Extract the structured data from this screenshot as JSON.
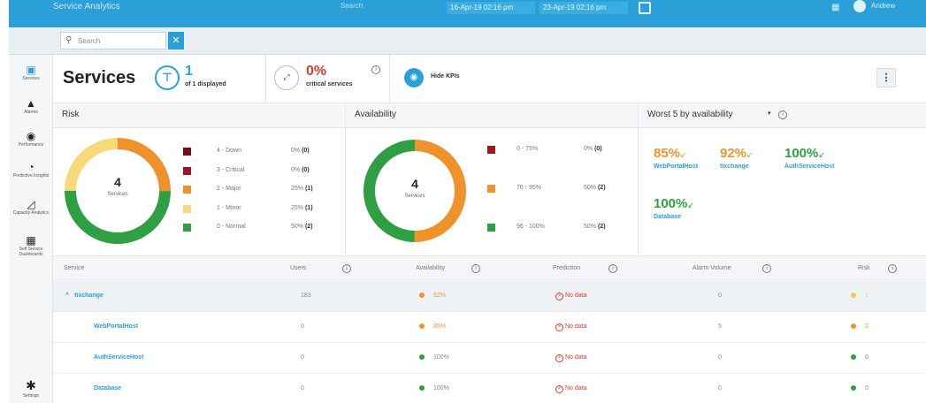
{
  "topbar": {
    "title": "Service Analytics",
    "search_placeholder": "Search",
    "date_from": "16-Apr-19 02:16 pm",
    "date_to": "23-Apr-19 02:16 pm",
    "user_label": "Andrew"
  },
  "subbar": {
    "search_placeholder": "Search",
    "clear_label": "✕"
  },
  "nav": [
    {
      "label": "Services",
      "icon": "services-icon",
      "glyph": "▣"
    },
    {
      "label": "Alarms",
      "icon": "alarm-icon",
      "glyph": "▲"
    },
    {
      "label": "Performance",
      "icon": "performance-icon",
      "glyph": "◉"
    },
    {
      "label": "Predictive Insights",
      "icon": "insights-icon",
      "glyph": "◔"
    },
    {
      "label": "Capacity Analytics",
      "icon": "capacity-icon",
      "glyph": "◿"
    },
    {
      "label": "Self Service Dashboards",
      "icon": "dashboards-icon",
      "glyph": "▦"
    }
  ],
  "settings": {
    "label": "Settings",
    "glyph": "✱"
  },
  "header": {
    "title": "Services",
    "displayed_count": "1",
    "displayed_sub": "of 1 displayed",
    "critical_pct": "0%",
    "critical_sub": "critical services",
    "hide_kpis": "Hide KPIs",
    "more": "⋮"
  },
  "panels": {
    "risk_title": "Risk",
    "availability_title": "Availability",
    "worst_title": "Worst 5 by availability"
  },
  "risk": {
    "total": "4",
    "total_label": "Services",
    "legend": [
      {
        "name": "4 - Down",
        "pct": "0%",
        "count": "(0)",
        "color": "#7a0c12"
      },
      {
        "name": "3 - Critical",
        "pct": "0%",
        "count": "(0)",
        "color": "#a4121c"
      },
      {
        "name": "2 - Major",
        "pct": "25%",
        "count": "(1)",
        "color": "#f0922b"
      },
      {
        "name": "1 - Minor",
        "pct": "25%",
        "count": "(1)",
        "color": "#f7d97a"
      },
      {
        "name": "0 - Normal",
        "pct": "50%",
        "count": "(2)",
        "color": "#2ea043"
      }
    ],
    "shares": [
      0,
      0,
      0.25,
      0.25,
      0.5
    ]
  },
  "availability": {
    "total": "4",
    "total_label": "Services",
    "legend": [
      {
        "name": "0 - 75%",
        "pct": "0%",
        "count": "(0)",
        "color": "#a4121c"
      },
      {
        "name": "76 - 95%",
        "pct": "50%",
        "count": "(2)",
        "color": "#f0922b"
      },
      {
        "name": "96 - 100%",
        "pct": "50%",
        "count": "(2)",
        "color": "#2ea043"
      }
    ],
    "shares": [
      0,
      0.5,
      0.5
    ]
  },
  "worst": [
    {
      "pct": "85%",
      "arrow": "↙",
      "host": "WebPortalHost",
      "color": "#f0922b"
    },
    {
      "pct": "92%",
      "arrow": "↙",
      "host": "tixchange",
      "color": "#f0922b"
    },
    {
      "pct": "100%",
      "arrow": "↙",
      "host": "AuthServiceHost",
      "color": "#2ea043"
    },
    {
      "pct": "100%",
      "arrow": "↙",
      "host": "Database",
      "color": "#2ea043"
    }
  ],
  "table": {
    "columns": [
      "Service",
      "Users",
      "Availability",
      "Prediction",
      "Alarm Volume",
      "Risk"
    ],
    "rows": [
      {
        "service": "tixchange",
        "group": true,
        "caret": "^",
        "users": "183",
        "avail": "92%",
        "avail_color": "#f0922b",
        "prediction": "No data",
        "alarms": "0",
        "risk": "1",
        "risk_color": "#f7c548"
      },
      {
        "service": "WebPortalHost",
        "group": false,
        "users": "0",
        "avail": "85%",
        "avail_color": "#f0922b",
        "prediction": "No data",
        "alarms": "5",
        "risk": "2",
        "risk_color": "#f0922b"
      },
      {
        "service": "AuthServiceHost",
        "group": false,
        "users": "0",
        "avail": "100%",
        "avail_color": "#2ea043",
        "prediction": "No data",
        "alarms": "0",
        "risk": "0",
        "risk_color": "#2ea043"
      },
      {
        "service": "Database",
        "group": false,
        "users": "0",
        "avail": "100%",
        "avail_color": "#2ea043",
        "prediction": "No data",
        "alarms": "0",
        "risk": "0",
        "risk_color": "#2ea043"
      }
    ]
  }
}
